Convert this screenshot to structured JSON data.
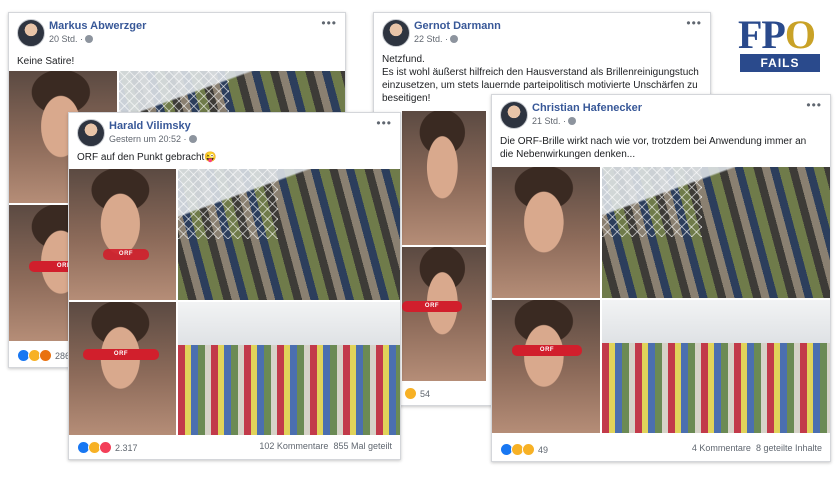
{
  "logo": {
    "brand_left": "FP",
    "brand_o": "O",
    "sub": "FAILS"
  },
  "posts": [
    {
      "name": "Markus Abwerzger",
      "meta": "20 Std. ·",
      "text": "Keine Satire!",
      "reactions_count": "286"
    },
    {
      "name": "Gernot Darmann",
      "meta": "22 Std. ·",
      "text": "Netzfund.\nEs ist wohl äußerst hilfreich den Hausverstand als Brillenreinigungstuch einzusetzen, um stets lauernde parteipolitisch motivierte Unschärfen zu beseitigen!",
      "reactions_count": "54"
    },
    {
      "name": "Harald Vilimsky",
      "meta": "Gestern um 20:52 ·",
      "text": "ORF auf den Punkt gebracht😜",
      "reactions_count": "2.317",
      "comments": "102 Kommentare",
      "shares": "855 Mal geteilt"
    },
    {
      "name": "Christian Hafenecker",
      "meta": "21 Std. ·",
      "text": "Die ORF-Brille wirkt nach wie vor, trotzdem bei Anwendung immer an die Nebenwirkungen denken...",
      "reactions_count": "49",
      "comments": "4 Kommentare",
      "shares": "8 geteilte Inhalte"
    }
  ],
  "glasses_label": "ORF",
  "more_label": "•••"
}
